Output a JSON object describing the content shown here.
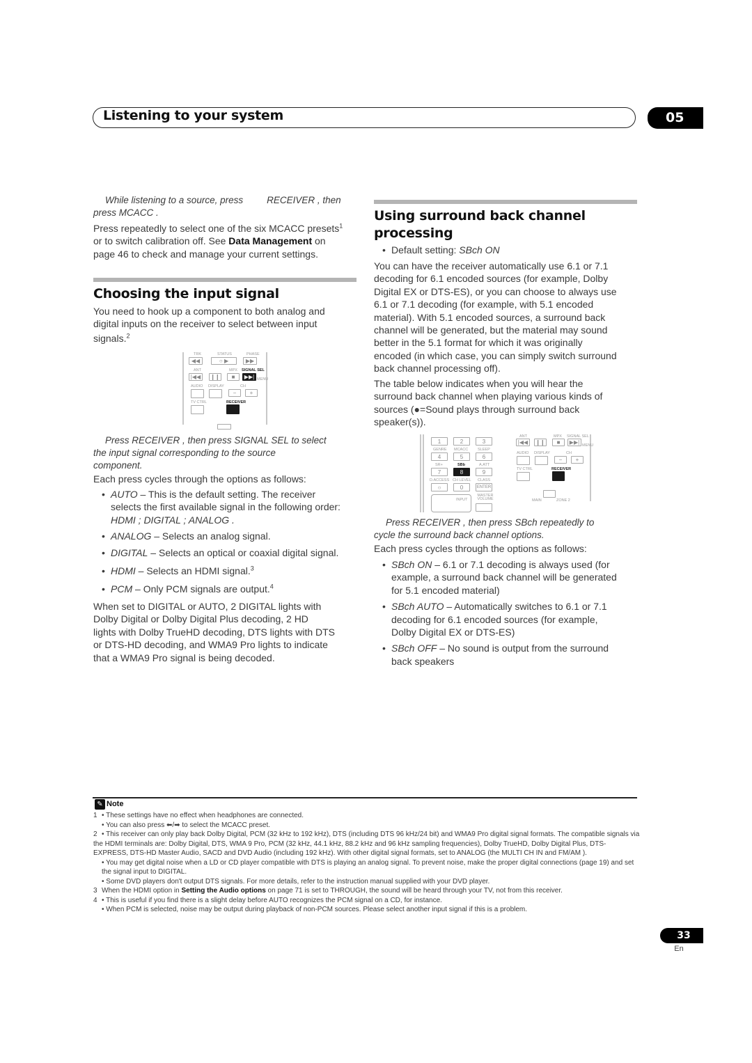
{
  "header": {
    "section_title": "Listening to your system",
    "chapter_number": "05"
  },
  "left_column": {
    "mcacc_step": {
      "instruction_a": "While listening to a source, press",
      "instruction_b": "RECEIVER , then",
      "instruction_c": "press  MCACC .",
      "para_a": "Press repeatedly to select one of the six MCACC presets",
      "para_sup": "1",
      "para_b": "or to switch calibration off. See ",
      "para_bold": "Data Management",
      "para_c": "on",
      "para_d": "page 46 to check and manage your current settings."
    },
    "input_signal": {
      "heading": "Choosing the input signal",
      "intro_a": "You need to hook up a component to both analog and",
      "intro_b": "digital inputs on the receiver to select between input",
      "intro_c": "signals.",
      "intro_sup": "2",
      "step_a": "Press   RECEIVER , then press   SIGNAL SEL  to select",
      "step_b": "the input signal corresponding to the source",
      "step_c": "component.",
      "cycle_text": "Each press cycles through the options as follows:",
      "options": [
        {
          "name": "AUTO",
          "desc_a": " – This is the default setting. The receiver",
          "desc_b": "selects the first available signal in the following order:",
          "desc_c": "HDMI ; DIGITAL  ; ANALOG  ."
        },
        {
          "name": "ANALOG",
          "desc_a": " – Selects an analog signal."
        },
        {
          "name": "DIGITAL",
          "desc_a": "  – Selects an optical or coaxial digital signal."
        },
        {
          "name": "HDMI",
          "desc_a": " – Selects an HDMI signal.",
          "sup": "3"
        },
        {
          "name": "PCM",
          "desc_a": " – Only PCM signals are output.",
          "sup": "4"
        }
      ],
      "closing": [
        "When set to DIGITAL  or AUTO, 2    DIGITAL  lights with",
        "Dolby Digital or Dolby Digital Plus decoding, 2   HD",
        "lights with Dolby TrueHD decoding, DTS  lights with DTS",
        "or DTS-HD decoding, and WMA9 Pro   lights to indicate",
        "that a WMA9 Pro signal is being decoded."
      ]
    },
    "remote_a": {
      "labels": [
        "TRK",
        "STATUS",
        "PHASE",
        "ANT",
        "MPX",
        "SIGNAL SEL",
        "MENU",
        "AUDIO",
        "DISPLAY",
        "CH",
        "TV CTRL",
        "RECEIVER"
      ],
      "glyphs": [
        "◀◀",
        "○  ▶",
        "▶▶",
        "|◀◀",
        "❙❙",
        "■",
        "▶▶|",
        "−",
        "+"
      ]
    }
  },
  "right_column": {
    "sbch": {
      "heading_a": "Using surround back channel",
      "heading_b": "processing",
      "default_label": "Default setting: ",
      "default_value": "SBch ON",
      "para1": [
        "You can have the receiver automatically use 6.1 or 7.1",
        "decoding for 6.1 encoded sources (for example, Dolby",
        "Digital EX or DTS-ES), or you can choose to always use",
        "6.1 or 7.1 decoding (for example, with 5.1 encoded",
        "material). With 5.1 encoded sources, a surround back",
        "channel will be generated, but the material may sound",
        "better in the 5.1 format for which it was originally",
        "encoded (in which case, you can simply switch surround",
        "back channel processing off)."
      ],
      "para2": [
        "The table below indicates when you will hear the",
        "surround back channel when playing various kinds of",
        "sources (●=Sound plays through surround back",
        "speaker(s))."
      ],
      "step_a": "Press   RECEIVER , then press   SBch repeatedly to",
      "step_b": "cycle the surround back channel options.",
      "cycle_text": "Each press cycles through the options as follows:",
      "options": [
        {
          "name": "SBch ON",
          "lines": [
            " – 6.1 or 7.1 decoding is always used (for",
            "example, a surround back channel will be generated",
            "for 5.1 encoded material)"
          ]
        },
        {
          "name": "SBch AUTO",
          "lines": [
            "  – Automatically switches to 6.1 or 7.1",
            "decoding for 6.1 encoded sources (for example,",
            "Dolby Digital EX or DTS-ES)"
          ]
        },
        {
          "name": "SBch OFF",
          "lines": [
            "  – No sound is output from the surround",
            "back speakers"
          ]
        }
      ]
    },
    "remote_b": {
      "keys": [
        "1",
        "2",
        "3",
        "4",
        "5",
        "6",
        "7",
        "8",
        "9",
        "○",
        "0",
        "ENTER"
      ],
      "key_labels": [
        "GENRE",
        "MCACC",
        "SLEEP",
        "SR+",
        "SBb",
        "A.ATT",
        "D.ACCESS",
        "CH LEVEL",
        "CLASS",
        "INPUT",
        "MASTER VOLUME"
      ]
    },
    "remote_c": {
      "labels": [
        "ANT",
        "MPX",
        "SIGNAL SEL",
        "MENU",
        "AUDIO",
        "DISPLAY",
        "CH",
        "TV CTRL",
        "RECEIVER",
        "MAIN",
        "ZONE 2"
      ],
      "glyphs": [
        "|◀◀",
        "❙❙",
        "■",
        "▶▶|",
        "−",
        "+"
      ]
    }
  },
  "notes": {
    "title": "Note",
    "items": [
      {
        "num": "1",
        "text": "• These settings have no effect when headphones are connected."
      },
      {
        "num": "",
        "text": "• You can also press ⬅/➡ to select the MCACC preset."
      },
      {
        "num": "2",
        "text": "• This receiver can only play back Dolby Digital, PCM (32 kHz to 192 kHz), DTS (including DTS 96 kHz/24 bit) and WMA9 Pro digital signal formats. The compatible signals via the HDMI terminals are: Dolby Digital, DTS, WMA 9 Pro, PCM (32 kHz, 44.1 kHz, 88.2 kHz and 96 kHz sampling frequencies), Dolby TrueHD, Dolby Digital Plus, DTS-EXPRESS, DTS-HD Master Audio, SACD and DVD Audio (including 192 kHz). With other digital signal formats, set to ANALOG  (the MULTI CH IN and  FM/AM )."
      },
      {
        "num": "",
        "text": "• You may get digital noise when a LD or CD player compatible with DTS is playing an analog signal. To prevent noise, make the proper digital connections (page 19) and set the signal input to DIGITAL."
      },
      {
        "num": "",
        "text": "• Some DVD players don't output DTS signals. For more details, refer to the instruction manual supplied with your DVD player."
      },
      {
        "num": "3",
        "text_a": "When the HDMI option in ",
        "text_bold": "Setting the Audio options",
        "text_b": " on page 71 is set to THROUGH, the sound will be heard through your TV, not from this receiver."
      },
      {
        "num": "4",
        "text": "• This is useful if you find there is a slight delay before AUTO recognizes the PCM signal on a CD, for instance."
      },
      {
        "num": "",
        "text": "• When PCM is selected, noise may be output during playback of non-PCM sources. Please select another input signal if this is a problem."
      }
    ]
  },
  "footer": {
    "page_number": "33",
    "language": "En"
  }
}
